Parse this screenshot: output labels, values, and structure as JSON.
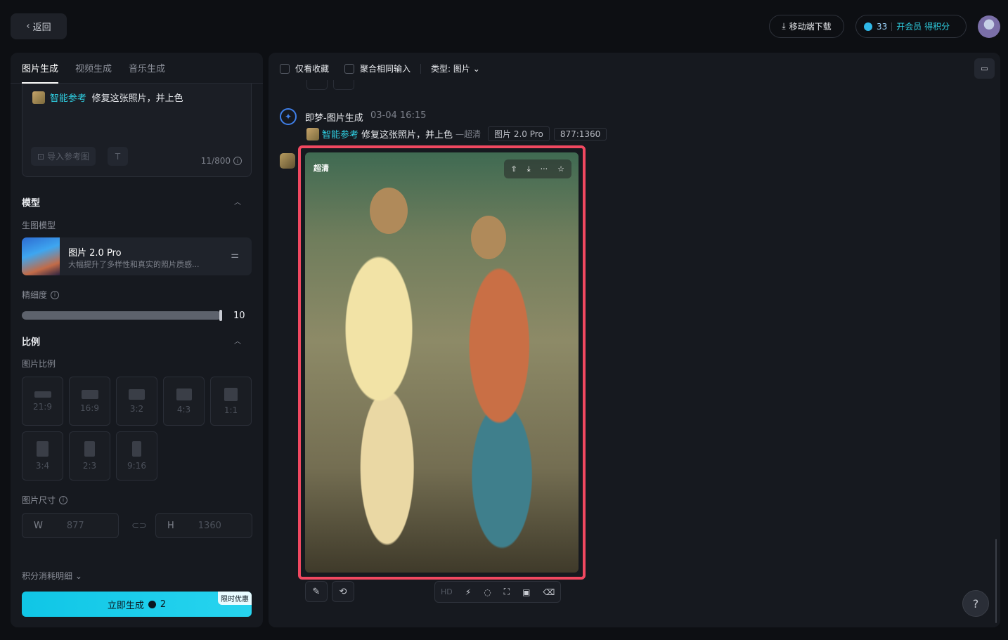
{
  "header": {
    "back_label": "返回",
    "download_label": "移动端下载",
    "credits": "33",
    "vip_label": "开会员 得积分"
  },
  "left": {
    "tabs": [
      "图片生成",
      "视频生成",
      "音乐生成"
    ],
    "prompt": {
      "ref_label": "智能参考",
      "text": "修复这张照片，并上色",
      "import_label": "导入参考图",
      "text_tool": "T",
      "counter": "11/800"
    },
    "model": {
      "section_title": "模型",
      "subtitle": "生图模型",
      "name": "图片 2.0 Pro",
      "desc": "大幅提升了多样性和真实的照片质感..."
    },
    "fineness": {
      "label": "精细度",
      "value": "10",
      "level_fraction": 1.0
    },
    "ratio": {
      "section_title": "比例",
      "subtitle": "图片比例",
      "options": [
        "21:9",
        "16:9",
        "3:2",
        "4:3",
        "1:1",
        "3:4",
        "2:3",
        "9:16"
      ]
    },
    "size": {
      "subtitle": "图片尺寸",
      "w_label": "W",
      "w_value": "877",
      "h_label": "H",
      "h_value": "1360"
    },
    "cost_label": "积分消耗明细",
    "generate_label": "立即生成",
    "generate_cost": "2",
    "promo_badge": "限时优惠"
  },
  "right": {
    "filters": {
      "favorites_label": "仅看收藏",
      "merge_label": "聚合相同输入",
      "type_label": "类型: 图片"
    },
    "message": {
      "bot_name": "即梦-图片生成",
      "time": "03-04  16:15",
      "ref_label": "智能参考",
      "prompt": "修复这张照片，并上色",
      "mode": "—超清",
      "model_tag": "图片 2.0 Pro",
      "ratio_tag": "877:1360",
      "image_badge": "超清"
    },
    "tools": {
      "hd_label": "HD"
    }
  },
  "help": "?"
}
